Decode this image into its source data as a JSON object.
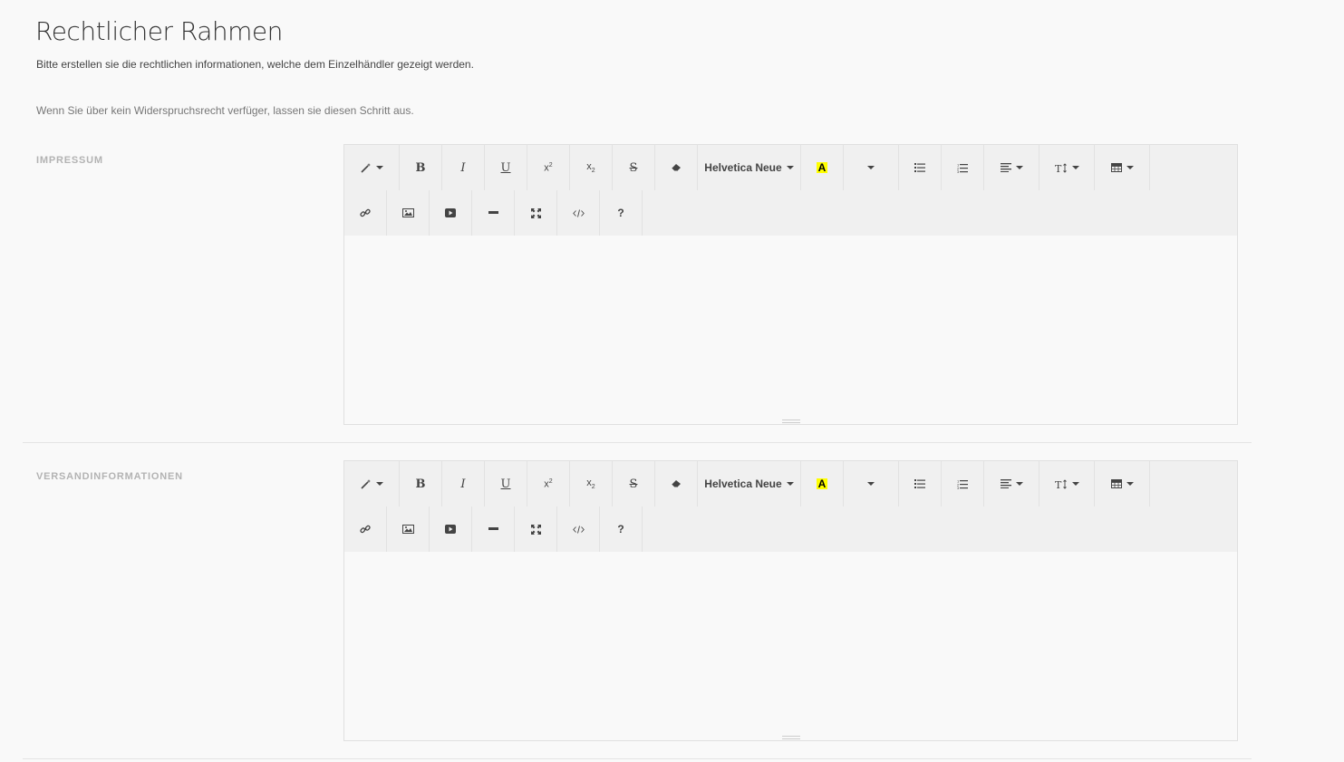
{
  "page": {
    "title": "Rechtlicher Rahmen",
    "subtitle": "Bitte erstellen sie die rechtlichen informationen, welche dem Einzelhändler gezeigt werden.",
    "note": "Wenn Sie über kein Widerspruchsrecht verfüger, lassen sie diesen Schritt aus."
  },
  "sections": [
    {
      "label": "IMPRESSUM"
    },
    {
      "label": "VERSANDINFORMATIONEN"
    }
  ],
  "toolbar": {
    "bold": "B",
    "italic": "I",
    "underline": "U",
    "font_name": "Helvetica Neue",
    "color_letter": "A",
    "help": "?"
  },
  "colors": {
    "highlight": "#ffff00",
    "toolbar_bg": "#f0f0f0",
    "page_bg": "#f9f9f9"
  },
  "icons": [
    "magic-icon",
    "eraser-icon",
    "list-ul-icon",
    "list-ol-icon",
    "align-icon",
    "text-height-icon",
    "table-icon",
    "link-icon",
    "image-icon",
    "video-icon",
    "hr-icon",
    "fullscreen-icon",
    "code-icon"
  ]
}
